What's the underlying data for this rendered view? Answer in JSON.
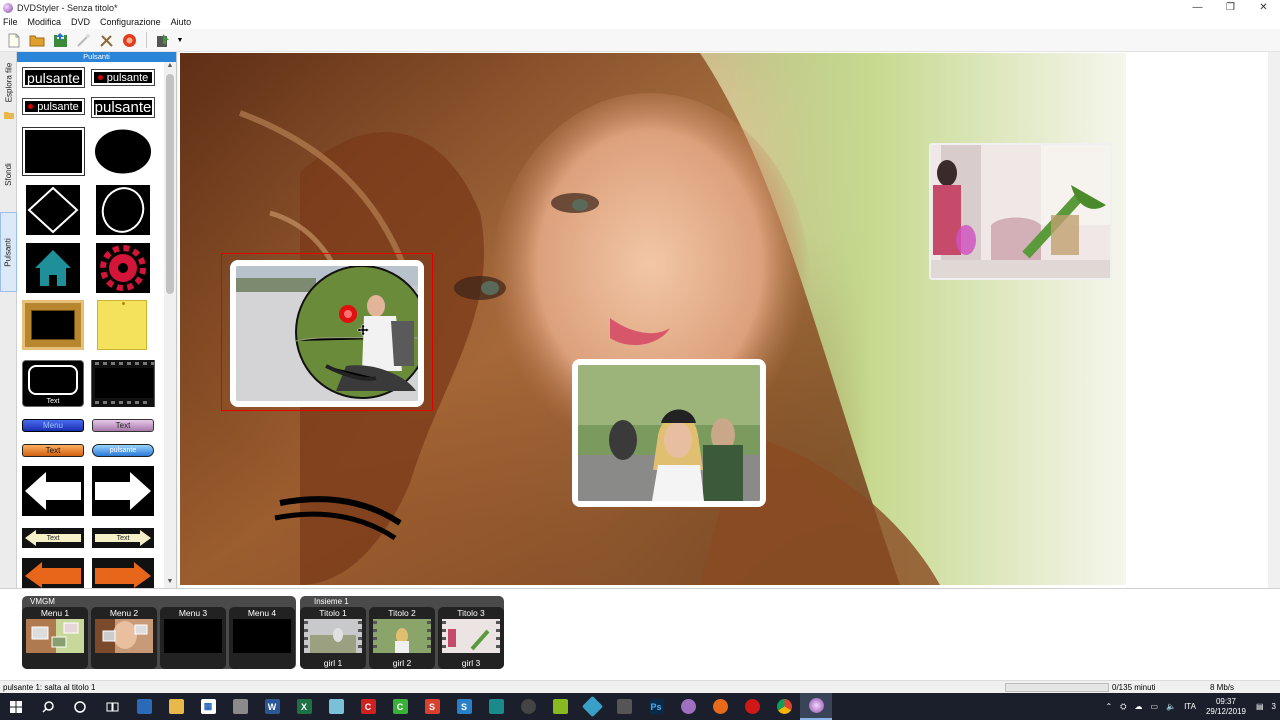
{
  "window": {
    "title": "DVDStyler - Senza titolo*",
    "controls": [
      "—",
      "❐",
      "✕"
    ]
  },
  "menu": [
    "File",
    "Modifica",
    "DVD",
    "Configurazione",
    "Aiuto"
  ],
  "side_tabs": [
    "Esplora file",
    "Sfondi",
    "Pulsanti"
  ],
  "palette": {
    "header": "Pulsanti",
    "btn1": "pulsante",
    "btn2": "pulsante",
    "btn3": "pulsante",
    "btn4": "pulsante",
    "frame_text": "Text",
    "menu_btn": "Menu",
    "text_btn1": "Text",
    "text_btn2": "Text",
    "pill_btn": "pulsante",
    "arrow_text1": "Text",
    "arrow_text2": "Text"
  },
  "film": {
    "group1_label": "VMGM",
    "group2_label": "Insieme 1",
    "menus": [
      "Menu 1",
      "Menu 2",
      "Menu 3",
      "Menu 4"
    ],
    "titles": [
      {
        "label": "Titolo 1",
        "sub": "girl 1"
      },
      {
        "label": "Titolo 2",
        "sub": "girl 2"
      },
      {
        "label": "Titolo 3",
        "sub": "girl 3"
      }
    ]
  },
  "status": {
    "left": "pulsante 1: salta al titolo 1",
    "minutes": "0/135 minuti",
    "rate": "8 Mb/s"
  },
  "taskbar": {
    "lang": "ITA",
    "time": "09:37",
    "date": "29/12/2019",
    "notif_count": "3"
  }
}
